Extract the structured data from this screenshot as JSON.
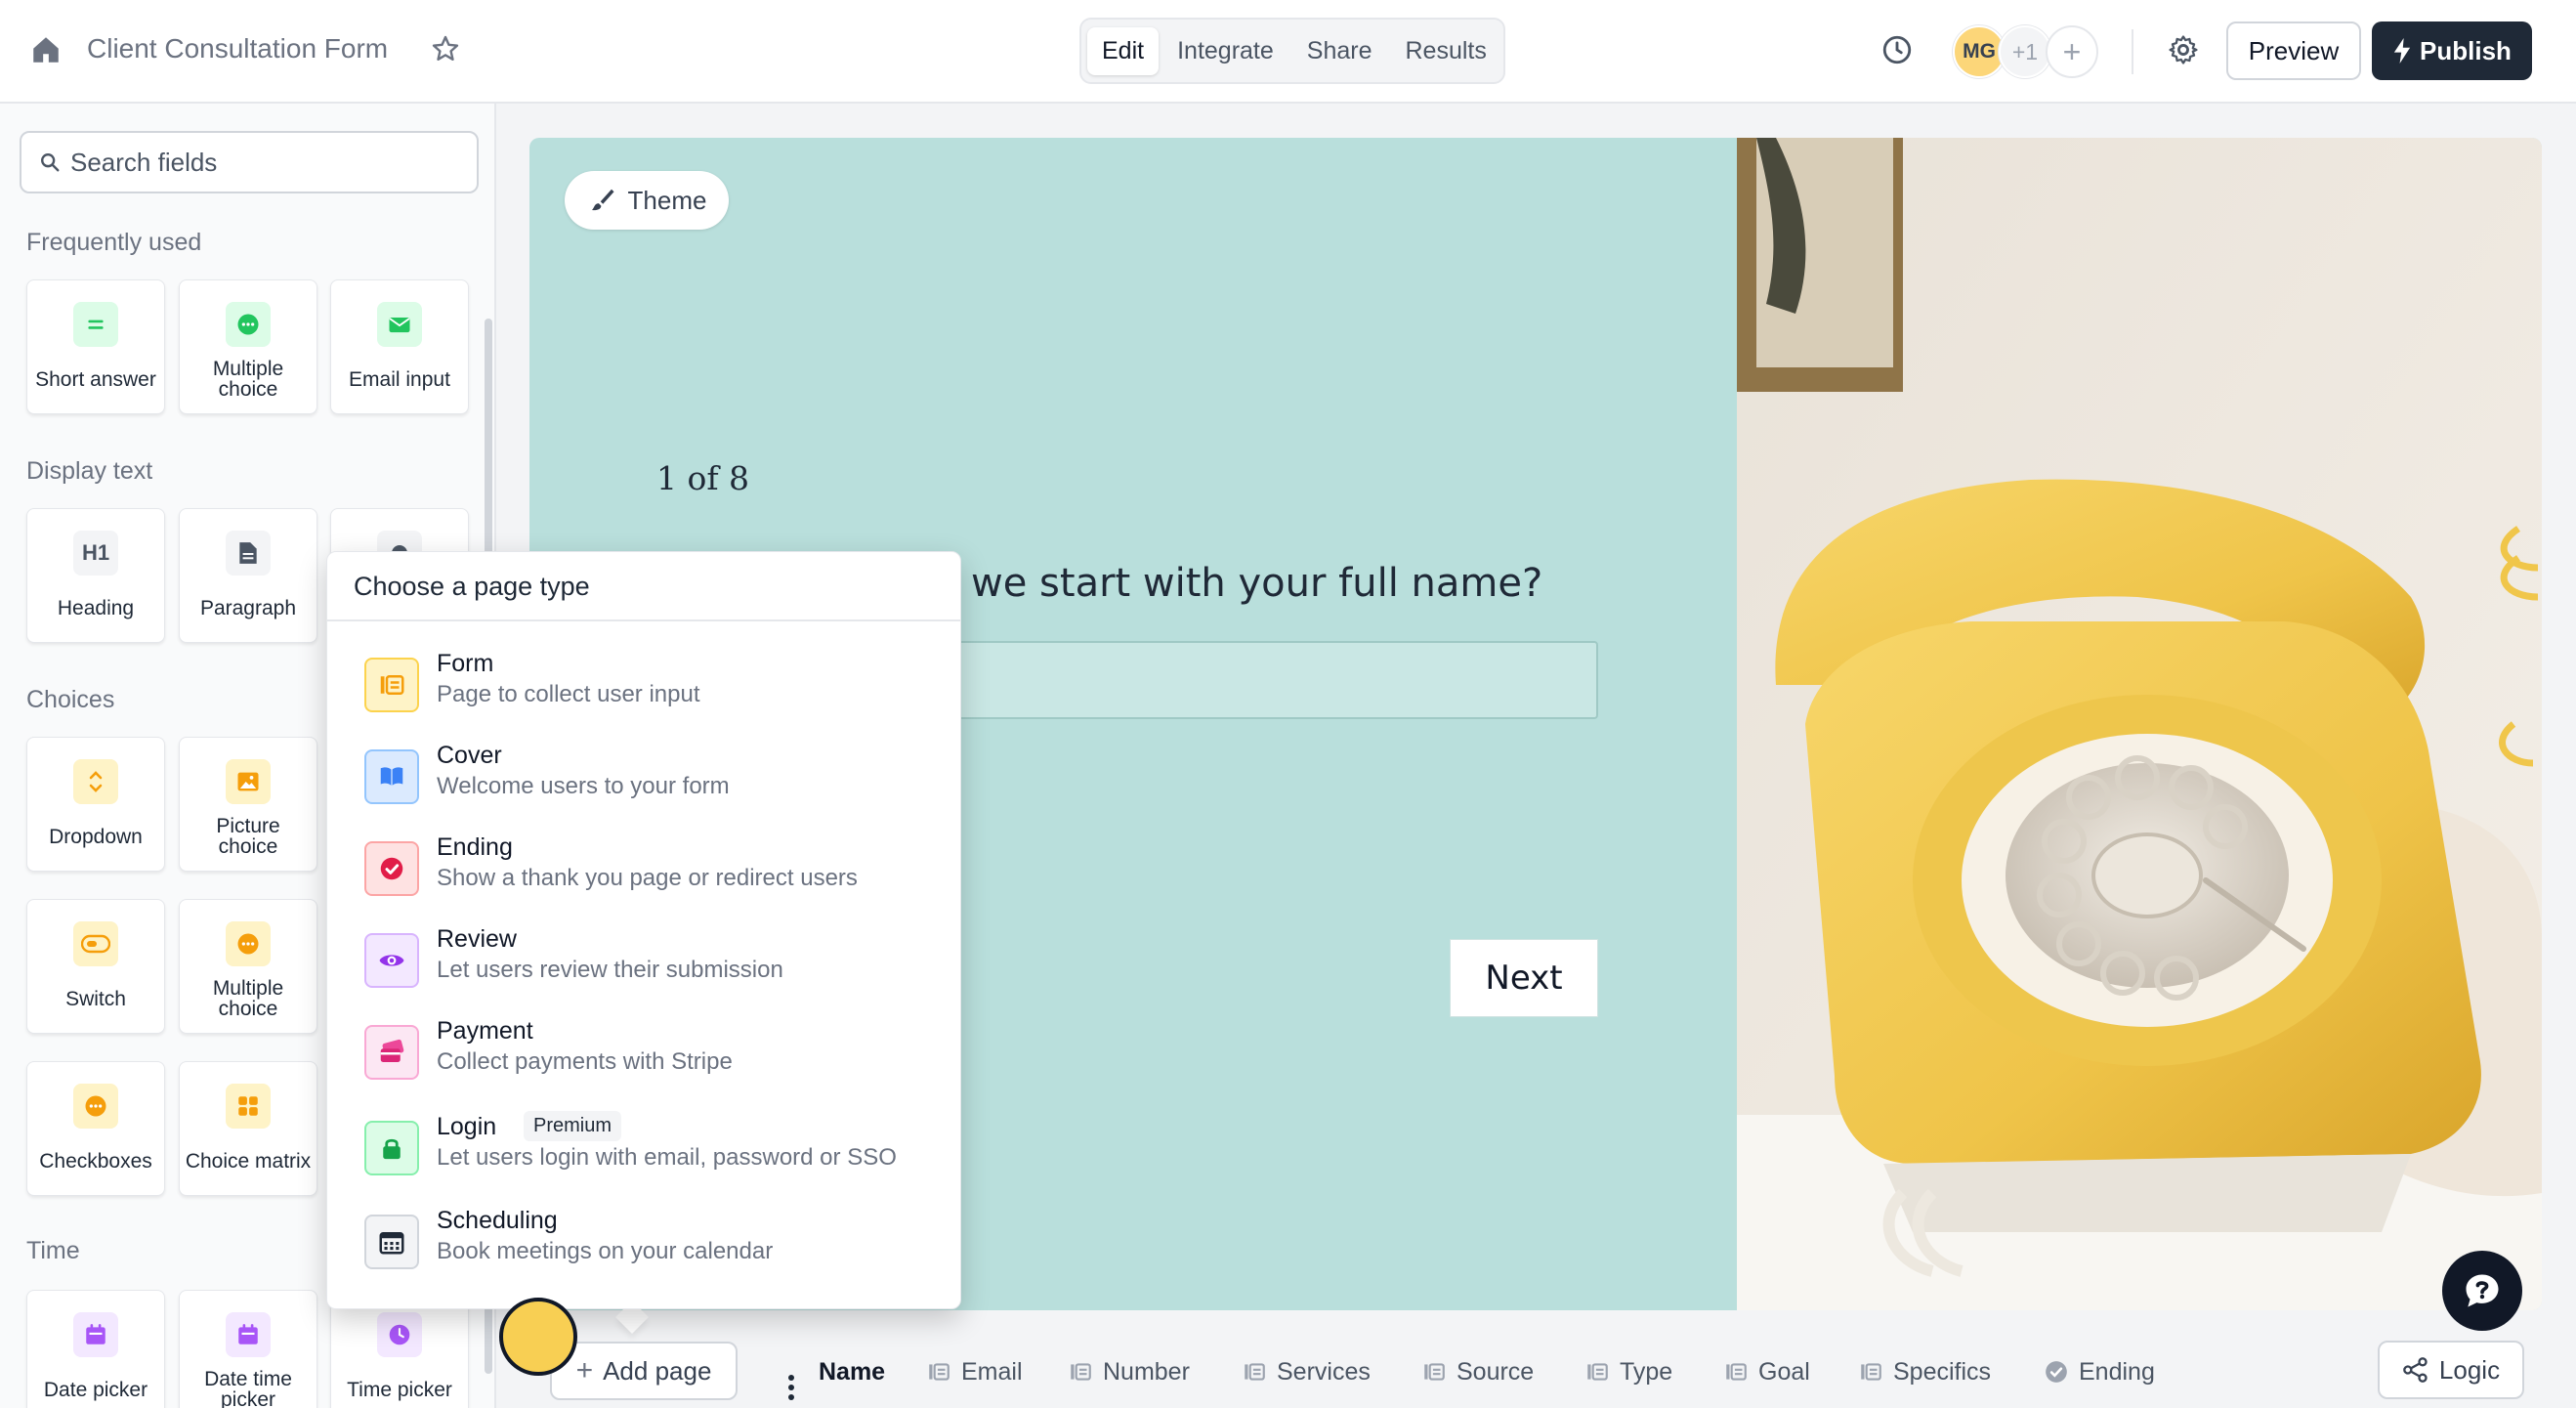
{
  "topbar": {
    "form_title": "Client Consultation Form",
    "tabs": [
      "Edit",
      "Integrate",
      "Share",
      "Results"
    ],
    "active_tab": "Edit",
    "avatar_initials": "MG",
    "avatar_extra": "+1",
    "preview_label": "Preview",
    "publish_label": "Publish"
  },
  "sidebar": {
    "search_placeholder": "Search fields",
    "sections": {
      "frequently_used": "Frequently used",
      "display_text": "Display text",
      "choices": "Choices",
      "time": "Time"
    },
    "fields": {
      "short_answer": "Short answer",
      "multiple_choice": "Multiple choice",
      "email_input": "Email input",
      "heading": "Heading",
      "paragraph": "Paragraph",
      "dropdown": "Dropdown",
      "picture_choice": "Picture choice",
      "switch": "Switch",
      "multiple_choice_2": "Multiple choice",
      "checkboxes": "Checkboxes",
      "choice_matrix": "Choice matrix",
      "date_picker": "Date picker",
      "date_time_picker": "Date time picker",
      "time_picker": "Time picker"
    }
  },
  "canvas": {
    "theme_label": "Theme",
    "step": "1 of 8",
    "question": "we start with your full name?",
    "next_label": "Next",
    "background_color": "#b9dfdc"
  },
  "popover": {
    "title": "Choose a page type",
    "items": [
      {
        "name": "Form",
        "desc": "Page to collect user input",
        "icon": "form-icon"
      },
      {
        "name": "Cover",
        "desc": "Welcome users to your form",
        "icon": "book-icon"
      },
      {
        "name": "Ending",
        "desc": "Show a thank you page or redirect users",
        "icon": "check-badge-icon"
      },
      {
        "name": "Review",
        "desc": "Let users review their submission",
        "icon": "eye-icon"
      },
      {
        "name": "Payment",
        "desc": "Collect payments with Stripe",
        "icon": "card-icon"
      },
      {
        "name": "Login",
        "desc": "Let users login with email, password or SSO",
        "icon": "lock-icon",
        "badge": "Premium"
      },
      {
        "name": "Scheduling",
        "desc": "Book meetings on your calendar",
        "icon": "calendar-icon"
      }
    ]
  },
  "bottombar": {
    "add_page_label": "Add page",
    "pages": [
      "Name",
      "Email",
      "Number",
      "Services",
      "Source",
      "Type",
      "Goal",
      "Specifics",
      "Ending"
    ],
    "active_page": "Name",
    "logic_label": "Logic"
  }
}
